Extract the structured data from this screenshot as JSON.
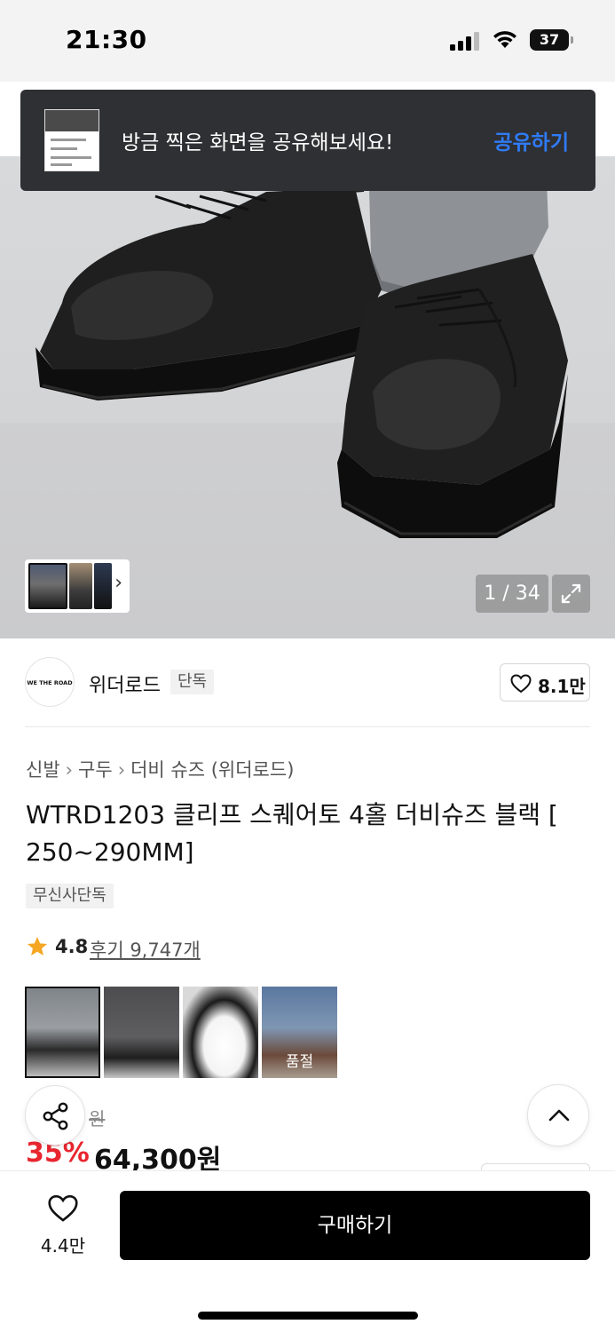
{
  "status_bar": {
    "time": "21:30",
    "battery": "37",
    "icons": [
      "signal-icon",
      "wifi-icon",
      "battery-icon"
    ]
  },
  "toast": {
    "message": "방금 찍은 화면을 공유해보세요!",
    "action_label": "공유하기"
  },
  "gallery": {
    "counter": "1 / 34",
    "thumbnail_chevron": "›"
  },
  "brand": {
    "logo_text": "WE THE ROAD",
    "name": "위더로드",
    "tag": "단독",
    "likes": "8.1만"
  },
  "breadcrumb": [
    "신발",
    "구두",
    "더비 슈즈 (위더로드)"
  ],
  "product": {
    "title": "WTRD1203 클리프 스퀘어토 4홀 더비슈즈 블랙 [ 250~290MM]",
    "exclusive_tag": "무신사단독",
    "rating": "4.8",
    "reviews": "후기 9,747개",
    "options": [
      {
        "name": "black-gray-jeans",
        "selected": true,
        "soldout": ""
      },
      {
        "name": "black-wide-pants",
        "selected": false,
        "soldout": ""
      },
      {
        "name": "white",
        "selected": false,
        "soldout": ""
      },
      {
        "name": "brown",
        "selected": false,
        "soldout": "품절"
      }
    ],
    "original_price_visible": "원",
    "discount": "35%",
    "price": "64,300원"
  },
  "bottom_bar": {
    "wish_count": "4.4만",
    "buy_label": "구매하기"
  },
  "colors": {
    "accent_blue": "#2f7bf6",
    "discount_red": "#e8262f",
    "buy_button": "#000000",
    "toast_bg": "#2f3033"
  }
}
